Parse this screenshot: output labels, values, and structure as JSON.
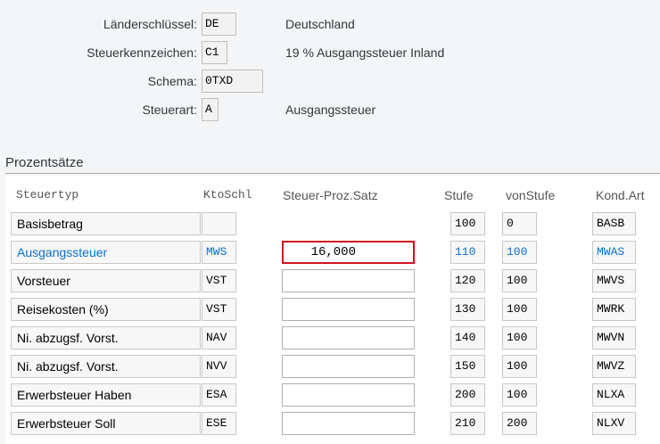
{
  "header": {
    "country_key": {
      "label": "Länderschlüssel:",
      "value": "DE",
      "desc": "Deutschland"
    },
    "tax_code": {
      "label": "Steuerkennzeichen:",
      "value": "C1",
      "desc": "19 % Ausgangssteuer Inland"
    },
    "procedure": {
      "label": "Schema:",
      "value": "0TXD"
    },
    "tax_type": {
      "label": "Steuerart:",
      "value": "A",
      "desc": "Ausgangssteuer"
    }
  },
  "section_title": "Prozentsätze",
  "columns": {
    "tax_type": "Steuertyp",
    "account_key": "KtoSchl",
    "tax_percent": "Steuer-Proz.Satz",
    "step": "Stufe",
    "from_step": "vonStufe",
    "cond_type": "Kond.Art"
  },
  "rows": [
    {
      "tax_type": "Basisbetrag",
      "account_key": "",
      "rate": null,
      "step": "100",
      "from_step": "0",
      "cond_type": "BASB"
    },
    {
      "tax_type": "Ausgangssteuer",
      "account_key": "MWS",
      "rate": "16,000",
      "step": "110",
      "from_step": "100",
      "cond_type": "MWAS"
    },
    {
      "tax_type": "Vorsteuer",
      "account_key": "VST",
      "rate": "",
      "step": "120",
      "from_step": "100",
      "cond_type": "MWVS"
    },
    {
      "tax_type": "Reisekosten (%)",
      "account_key": "VST",
      "rate": "",
      "step": "130",
      "from_step": "100",
      "cond_type": "MWRK"
    },
    {
      "tax_type": "Ni. abzugsf. Vorst.",
      "account_key": "NAV",
      "rate": "",
      "step": "140",
      "from_step": "100",
      "cond_type": "MWVN"
    },
    {
      "tax_type": "Ni. abzugsf. Vorst.",
      "account_key": "NVV",
      "rate": "",
      "step": "150",
      "from_step": "100",
      "cond_type": "MWVZ"
    },
    {
      "tax_type": "Erwerbsteuer Haben",
      "account_key": "ESA",
      "rate": "",
      "step": "200",
      "from_step": "100",
      "cond_type": "NLXA"
    },
    {
      "tax_type": "Erwerbsteuer Soll",
      "account_key": "ESE",
      "rate": "",
      "step": "210",
      "from_step": "200",
      "cond_type": "NLXV"
    }
  ],
  "colors": {
    "link": "#0a6ed1",
    "focus_border": "#d0121e"
  }
}
